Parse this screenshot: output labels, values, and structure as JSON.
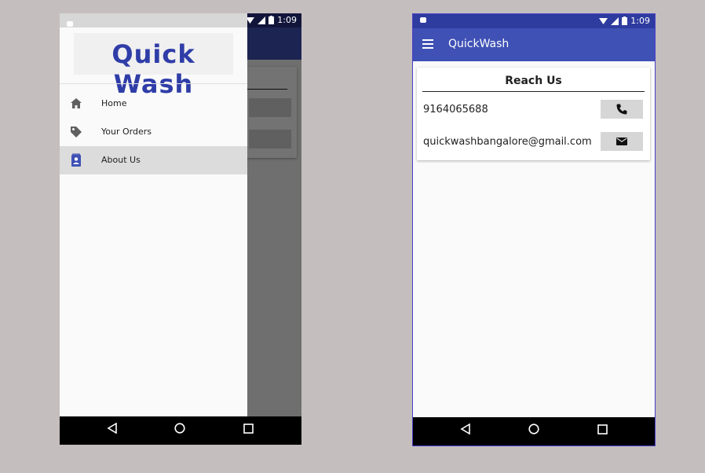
{
  "status": {
    "time": "1:09"
  },
  "drawer": {
    "logo": "Quick Wash",
    "items": [
      {
        "label": "Home",
        "icon": "home-icon"
      },
      {
        "label": "Your Orders",
        "icon": "tag-icon"
      },
      {
        "label": "About Us",
        "icon": "contact-card-icon",
        "active": true
      }
    ]
  },
  "app": {
    "title": "QuickWash",
    "card": {
      "heading": "Reach Us",
      "phone": "9164065688",
      "email": "quickwashbangalore@gmail.com"
    }
  },
  "colors": {
    "primary": "#3f51b5",
    "primary_dark": "#2e3b9f",
    "accent_logo": "#2f3da8"
  }
}
